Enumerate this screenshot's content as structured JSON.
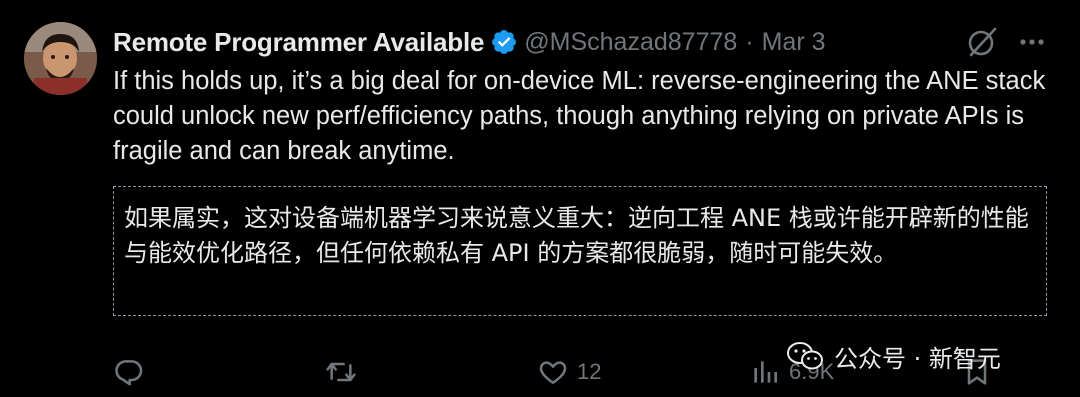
{
  "tweet": {
    "display_name": "Remote Programmer Available",
    "handle": "@MSchazad87778",
    "separator": "·",
    "date": "Mar 3",
    "text": "If this holds up, it’s a big deal for on-device ML: reverse-engineering the ANE stack could unlock new perf/efficiency paths, though anything relying on private APIs is fragile and can break anytime.",
    "translation": "如果属实，这对设备端机器学习来说意义重大：逆向工程 ANE 栈或许能开辟新的性能与能效优化路径，但任何依赖私有 API 的方案都很脆弱，随时可能失效。"
  },
  "actions": {
    "reply_icon": "reply-icon",
    "retweet_icon": "retweet-icon",
    "like_icon": "heart-icon",
    "like_count": "12",
    "views_icon": "views-icon",
    "views_count": "6.9K",
    "bookmark_icon": "bookmark-icon"
  },
  "watermark": {
    "text": "公众号 · 新智元",
    "icon": "wechat-icon"
  },
  "colors": {
    "background": "#000000",
    "text_primary": "#e7e9ea",
    "text_secondary": "#71767b",
    "verified_blue": "#1d9bf0"
  }
}
